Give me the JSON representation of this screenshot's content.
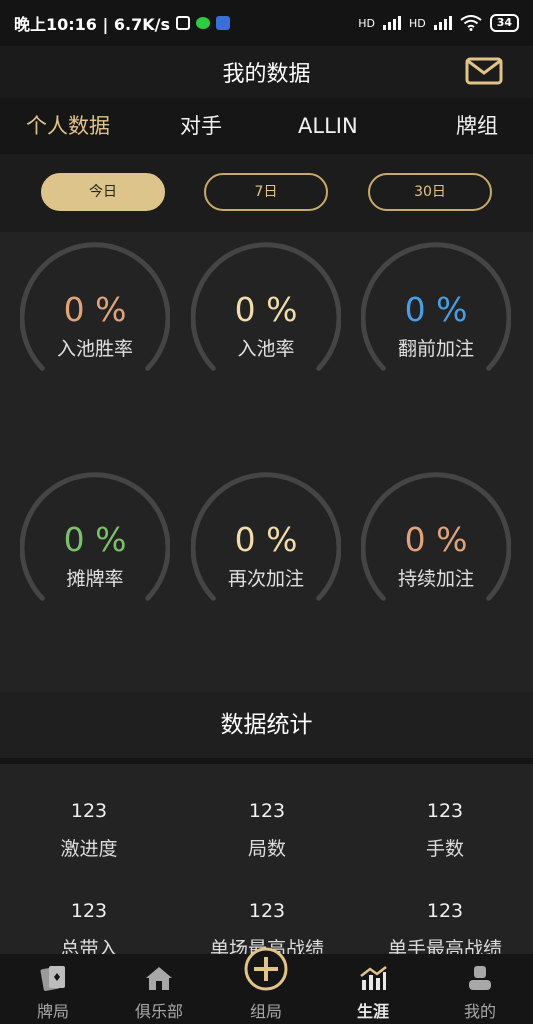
{
  "status_bar": {
    "time_speed": "晚上10:16 | 6.7K/s",
    "hd1": "HD",
    "hd2": "HD",
    "battery": "34"
  },
  "header": {
    "title": "我的数据",
    "mail_icon": "mail-icon"
  },
  "tabs": [
    {
      "label": "个人数据",
      "active": true
    },
    {
      "label": "对手",
      "active": false
    },
    {
      "label": "ALLIN",
      "active": false
    },
    {
      "label": "牌组",
      "active": false
    }
  ],
  "periods": [
    {
      "label": "今日",
      "active": true
    },
    {
      "label": "7日",
      "active": false
    },
    {
      "label": "30日",
      "active": false
    }
  ],
  "gauges": [
    {
      "value": "0 %",
      "label": "入池胜率",
      "color": "#e0a37a"
    },
    {
      "value": "0 %",
      "label": "入池率",
      "color": "#f1dcaa"
    },
    {
      "value": "0 %",
      "label": "翻前加注",
      "color": "#4a9ee6"
    },
    {
      "value": "0 %",
      "label": "摊牌率",
      "color": "#7cc06a"
    },
    {
      "value": "0 %",
      "label": "再次加注",
      "color": "#f1dcaa"
    },
    {
      "value": "0 %",
      "label": "持续加注",
      "color": "#e0a37a"
    }
  ],
  "stats_title": "数据统计",
  "stats": [
    {
      "value": "123",
      "label": "激进度"
    },
    {
      "value": "123",
      "label": "局数"
    },
    {
      "value": "123",
      "label": "手数"
    },
    {
      "value": "123",
      "label": "总带入"
    },
    {
      "value": "123",
      "label": "单场最高战绩"
    },
    {
      "value": "123",
      "label": "单手最高战绩"
    }
  ],
  "nav": [
    {
      "label": "牌局",
      "icon": "cards-icon",
      "active": false
    },
    {
      "label": "俱乐部",
      "icon": "house-icon",
      "active": false
    },
    {
      "label": "组局",
      "icon": "plus-circle-icon",
      "active": false
    },
    {
      "label": "生涯",
      "icon": "chart-icon",
      "active": true
    },
    {
      "label": "我的",
      "icon": "user-icon",
      "active": false
    }
  ],
  "colors": {
    "accent": "#e2c487",
    "background": "#1f1f1f",
    "gauge_track": "#454545"
  }
}
